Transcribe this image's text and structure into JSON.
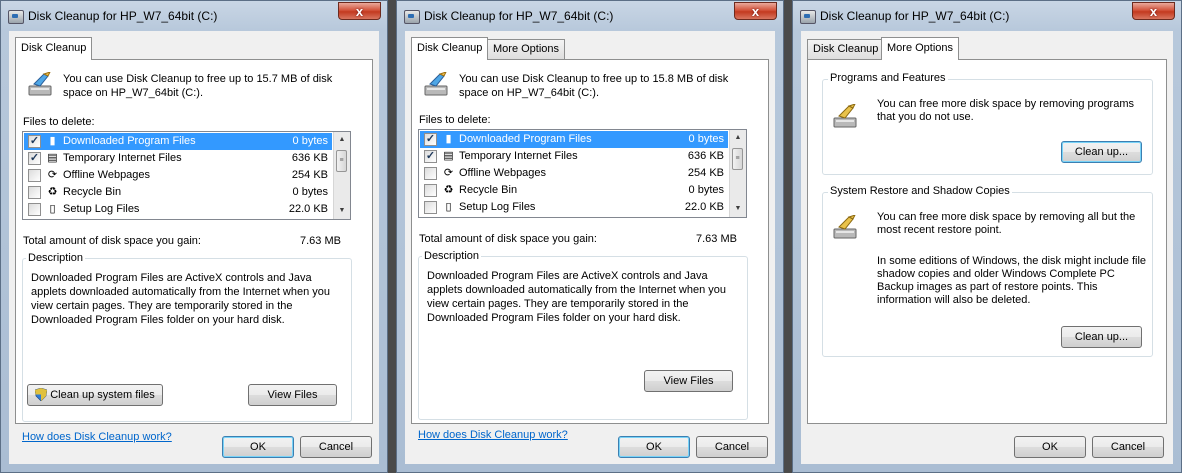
{
  "windows": [
    {
      "title": "Disk Cleanup for HP_W7_64bit (C:)",
      "close_glyph": "x",
      "tabs": [
        "Disk Cleanup"
      ],
      "intro": "You can use Disk Cleanup to free up to 15.7 MB of disk space on HP_W7_64bit (C:).",
      "files_label": "Files to delete:",
      "files": [
        {
          "name": "Downloaded Program Files",
          "size": "0 bytes",
          "checked": true,
          "selected": true,
          "icon": "folder-icon"
        },
        {
          "name": "Temporary Internet Files",
          "size": "636 KB",
          "checked": true,
          "selected": false,
          "icon": "document-icon"
        },
        {
          "name": "Offline Webpages",
          "size": "254 KB",
          "checked": false,
          "selected": false,
          "icon": "offline-page-icon"
        },
        {
          "name": "Recycle Bin",
          "size": "0 bytes",
          "checked": false,
          "selected": false,
          "icon": "recycle-bin-icon"
        },
        {
          "name": "Setup Log Files",
          "size": "22.0 KB",
          "checked": false,
          "selected": false,
          "icon": "text-file-icon"
        }
      ],
      "total_label": "Total amount of disk space you gain:",
      "total_value": "7.63 MB",
      "description_label": "Description",
      "description": "Downloaded Program Files are ActiveX controls and Java applets downloaded automatically from the Internet when you view certain pages. They are temporarily stored in the Downloaded Program Files folder on your hard disk.",
      "cleanup_system_label": "Clean up system files",
      "view_files_label": "View Files",
      "help_link": "How does Disk Cleanup work?",
      "ok_label": "OK",
      "cancel_label": "Cancel"
    },
    {
      "title": "Disk Cleanup for HP_W7_64bit (C:)",
      "close_glyph": "x",
      "tabs": [
        "Disk Cleanup",
        "More Options"
      ],
      "intro": "You can use Disk Cleanup to free up to 15.8 MB of disk space on HP_W7_64bit (C:).",
      "files_label": "Files to delete:",
      "files": [
        {
          "name": "Downloaded Program Files",
          "size": "0 bytes",
          "checked": true,
          "selected": true,
          "icon": "folder-icon"
        },
        {
          "name": "Temporary Internet Files",
          "size": "636 KB",
          "checked": true,
          "selected": false,
          "icon": "document-icon"
        },
        {
          "name": "Offline Webpages",
          "size": "254 KB",
          "checked": false,
          "selected": false,
          "icon": "offline-page-icon"
        },
        {
          "name": "Recycle Bin",
          "size": "0 bytes",
          "checked": false,
          "selected": false,
          "icon": "recycle-bin-icon"
        },
        {
          "name": "Setup Log Files",
          "size": "22.0 KB",
          "checked": false,
          "selected": false,
          "icon": "text-file-icon"
        }
      ],
      "total_label": "Total amount of disk space you gain:",
      "total_value": "7.63 MB",
      "description_label": "Description",
      "description": "Downloaded Program Files are ActiveX controls and Java applets downloaded automatically from the Internet when you view certain pages. They are temporarily stored in the Downloaded Program Files folder on your hard disk.",
      "view_files_label": "View Files",
      "help_link": "How does Disk Cleanup work?",
      "ok_label": "OK",
      "cancel_label": "Cancel"
    },
    {
      "title": "Disk Cleanup for HP_W7_64bit (C:)",
      "close_glyph": "x",
      "tabs": [
        "Disk Cleanup",
        "More Options"
      ],
      "programs_group_label": "Programs and Features",
      "programs_text": "You can free more disk space by removing programs that you do not use.",
      "programs_button": "Clean up...",
      "restore_group_label": "System Restore and Shadow Copies",
      "restore_text": "You can free more disk space by removing all but the most recent restore point.",
      "restore_note": "In some editions of Windows, the disk might include file shadow copies and older Windows Complete PC Backup images as part of restore points. This information will also be deleted.",
      "restore_button": "Clean up...",
      "ok_label": "OK",
      "cancel_label": "Cancel"
    }
  ],
  "colors": {
    "selection": "#3399ff",
    "link": "#0066cc",
    "close_red": "#c33a20"
  }
}
